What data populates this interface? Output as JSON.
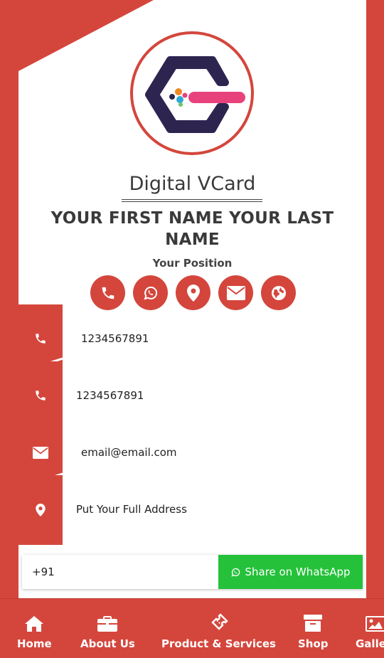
{
  "colors": {
    "accent": "#d4463c",
    "card": "#ffffff",
    "whatsapp_green": "#25c13a",
    "text_dark": "#3a3a3a"
  },
  "brand": {
    "title": "Digital VCard",
    "logo_icon": "hexagon-logo-icon"
  },
  "profile": {
    "name": "YOUR FIRST NAME YOUR LAST NAME",
    "position": "Your Position"
  },
  "quick_actions": [
    {
      "icon": "phone-icon"
    },
    {
      "icon": "whatsapp-icon"
    },
    {
      "icon": "map-pin-icon"
    },
    {
      "icon": "envelope-icon"
    },
    {
      "icon": "globe-icon"
    }
  ],
  "contacts": [
    {
      "icon": "phone-icon",
      "value": "1234567891"
    },
    {
      "icon": "phone-icon",
      "value": "1234567891"
    },
    {
      "icon": "envelope-icon",
      "value": "email@email.com"
    },
    {
      "icon": "map-pin-icon",
      "value": "Put Your Full Address"
    }
  ],
  "share": {
    "input_value": "+91",
    "button_label": "Share on WhatsApp",
    "button_icon": "whatsapp-icon"
  },
  "nav": [
    {
      "label": "Home",
      "icon": "home-icon"
    },
    {
      "label": "About Us",
      "icon": "briefcase-icon"
    },
    {
      "label": "Product & Services",
      "icon": "ticket-icon"
    },
    {
      "label": "Shop",
      "icon": "archive-box-icon"
    },
    {
      "label": "Gallery",
      "icon": "image-icon"
    }
  ]
}
